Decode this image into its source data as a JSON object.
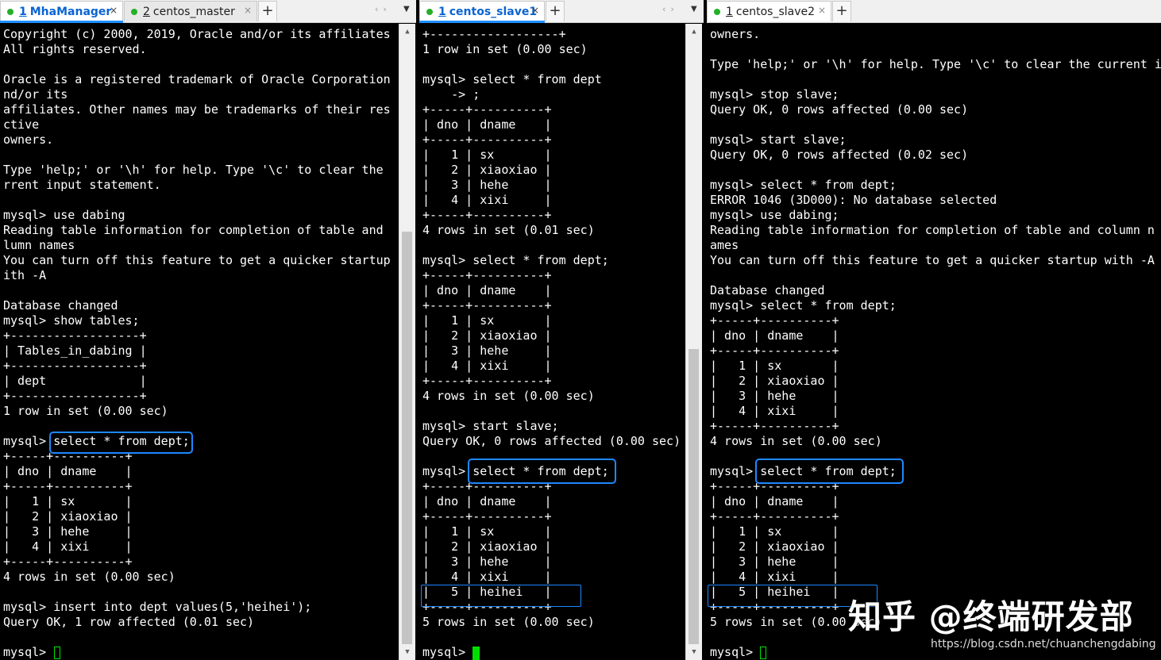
{
  "panes": [
    {
      "tabs": [
        {
          "num": "1",
          "name": "MhaManager",
          "active": true
        },
        {
          "num": "2",
          "name": "centos_master",
          "active": false
        }
      ],
      "plus": "+",
      "close": "×",
      "lines": [
        "Copyright (c) 2000, 2019, Oracle and/or its affiliates",
        "All rights reserved.",
        "",
        "Oracle is a registered trademark of Oracle Corporation",
        "nd/or its",
        "affiliates. Other names may be trademarks of their res",
        "ctive",
        "owners.",
        "",
        "Type 'help;' or '\\h' for help. Type '\\c' to clear the",
        "rrent input statement.",
        "",
        "mysql> use dabing",
        "Reading table information for completion of table and",
        "lumn names",
        "You can turn off this feature to get a quicker startup",
        "ith -A",
        "",
        "Database changed",
        "mysql> show tables;",
        "+------------------+",
        "| Tables_in_dabing |",
        "+------------------+",
        "| dept             |",
        "+------------------+",
        "1 row in set (0.00 sec)",
        "",
        "mysql> select * from dept;",
        "+-----+----------+",
        "| dno | dname    |",
        "+-----+----------+",
        "|   1 | sx       |",
        "|   2 | xiaoxiao |",
        "|   3 | hehe     |",
        "|   4 | xixi     |",
        "+-----+----------+",
        "4 rows in set (0.00 sec)",
        "",
        "mysql> insert into dept values(5,'heihei');",
        "Query OK, 1 row affected (0.01 sec)",
        "",
        "mysql> "
      ]
    },
    {
      "tabs": [
        {
          "num": "1",
          "name": "centos_slave1",
          "active": true
        }
      ],
      "plus": "+",
      "close": "×",
      "lines": [
        "+------------------+",
        "1 row in set (0.00 sec)",
        "",
        "mysql> select * from dept",
        "    -> ;",
        "+-----+----------+",
        "| dno | dname    |",
        "+-----+----------+",
        "|   1 | sx       |",
        "|   2 | xiaoxiao |",
        "|   3 | hehe     |",
        "|   4 | xixi     |",
        "+-----+----------+",
        "4 rows in set (0.01 sec)",
        "",
        "mysql> select * from dept;",
        "+-----+----------+",
        "| dno | dname    |",
        "+-----+----------+",
        "|   1 | sx       |",
        "|   2 | xiaoxiao |",
        "|   3 | hehe     |",
        "|   4 | xixi     |",
        "+-----+----------+",
        "4 rows in set (0.00 sec)",
        "",
        "mysql> start slave;",
        "Query OK, 0 rows affected (0.00 sec)",
        "",
        "mysql> select * from dept;",
        "+-----+----------+",
        "| dno | dname    |",
        "+-----+----------+",
        "|   1 | sx       |",
        "|   2 | xiaoxiao |",
        "|   3 | hehe     |",
        "|   4 | xixi     |",
        "|   5 | heihei   |",
        "+-----+----------+",
        "5 rows in set (0.00 sec)",
        "",
        "mysql> "
      ]
    },
    {
      "tabs": [
        {
          "num": "1",
          "name": "centos_slave2",
          "active": false
        }
      ],
      "plus": "+",
      "close": "×",
      "lines": [
        "owners.",
        "",
        "Type 'help;' or '\\h' for help. Type '\\c' to clear the current i",
        "",
        "mysql> stop slave;",
        "Query OK, 0 rows affected (0.00 sec)",
        "",
        "mysql> start slave;",
        "Query OK, 0 rows affected (0.02 sec)",
        "",
        "mysql> select * from dept;",
        "ERROR 1046 (3D000): No database selected",
        "mysql> use dabing;",
        "Reading table information for completion of table and column n",
        "ames",
        "You can turn off this feature to get a quicker startup with -A",
        "",
        "Database changed",
        "mysql> select * from dept;",
        "+-----+----------+",
        "| dno | dname    |",
        "+-----+----------+",
        "|   1 | sx       |",
        "|   2 | xiaoxiao |",
        "|   3 | hehe     |",
        "|   4 | xixi     |",
        "+-----+----------+",
        "4 rows in set (0.00 sec)",
        "",
        "mysql> select * from dept;",
        "+-----+----------+",
        "| dno | dname    |",
        "+-----+----------+",
        "|   1 | sx       |",
        "|   2 | xiaoxiao |",
        "|   3 | hehe     |",
        "|   4 | xixi     |",
        "|   5 | heihei   |",
        "+-----+----------+",
        "5 rows in set (0.00 sec)",
        "",
        "mysql> "
      ]
    }
  ],
  "watermark": "知乎 @终端研发部",
  "source_url": "https://blog.csdn.net/chuanchengdabing",
  "colors": {
    "highlight": "#1e88ff",
    "cursor": "#00e000",
    "active_tab_text": "#0a64d2",
    "status_dot": "#25b027"
  }
}
